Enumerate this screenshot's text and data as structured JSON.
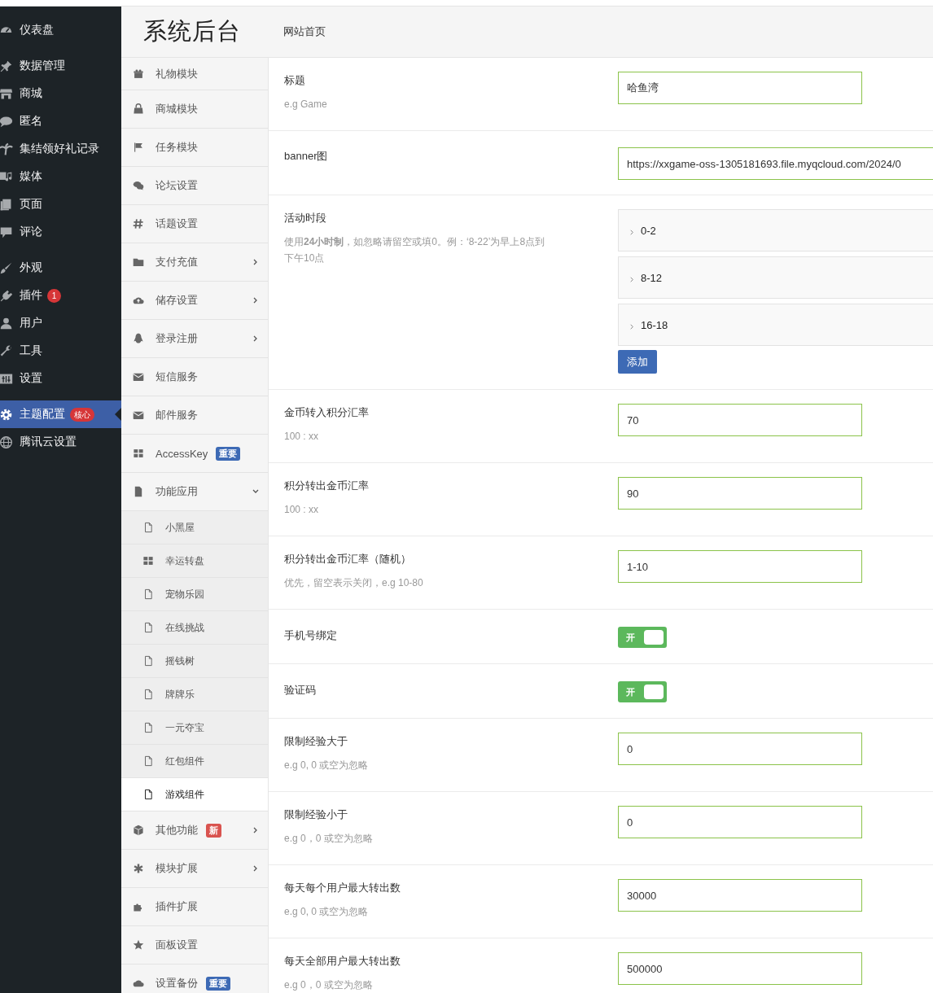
{
  "sidebar": {
    "items": [
      {
        "label": "仪表盘",
        "selected": false
      },
      {
        "label": "数据管理",
        "selected": false
      },
      {
        "label": "商城",
        "selected": false
      },
      {
        "label": "匿名",
        "selected": false
      },
      {
        "label": "集结领好礼记录",
        "selected": false
      },
      {
        "label": "媒体",
        "selected": false
      },
      {
        "label": "页面",
        "selected": false
      },
      {
        "label": "评论",
        "selected": false
      },
      {
        "label": "外观",
        "selected": false
      },
      {
        "label": "插件",
        "selected": false,
        "badge": "1"
      },
      {
        "label": "用户",
        "selected": false
      },
      {
        "label": "工具",
        "selected": false
      },
      {
        "label": "设置",
        "selected": false
      },
      {
        "label": "主题配置",
        "selected": true,
        "badge": "核心"
      },
      {
        "label": "腾讯云设置",
        "selected": false
      }
    ]
  },
  "header": {
    "title": "系统后台",
    "link": "网站首页"
  },
  "nav": {
    "items": [
      {
        "label": "礼物模块",
        "submenu": false
      },
      {
        "label": "商城模块",
        "submenu": false
      },
      {
        "label": "任务模块",
        "submenu": false
      },
      {
        "label": "论坛设置",
        "submenu": false
      },
      {
        "label": "话题设置",
        "submenu": false
      },
      {
        "label": "支付充值",
        "submenu": true,
        "expanded": false
      },
      {
        "label": "储存设置",
        "submenu": true,
        "expanded": false
      },
      {
        "label": "登录注册",
        "submenu": true,
        "expanded": false
      },
      {
        "label": "短信服务",
        "submenu": false
      },
      {
        "label": "邮件服务",
        "submenu": false
      },
      {
        "label": "AccessKey",
        "submenu": false,
        "badge": "重要",
        "color": "#3d6ab5"
      },
      {
        "label": "功能应用",
        "submenu": true,
        "expanded": true,
        "children": [
          {
            "label": "小黑屋",
            "selected": false
          },
          {
            "label": "幸运转盘",
            "selected": false
          },
          {
            "label": "宠物乐园",
            "selected": false
          },
          {
            "label": "在线挑战",
            "selected": false
          },
          {
            "label": "摇钱树",
            "selected": false
          },
          {
            "label": "牌牌乐",
            "selected": false
          },
          {
            "label": "一元夺宝",
            "selected": false
          },
          {
            "label": "红包组件",
            "selected": false
          },
          {
            "label": "游戏组件",
            "selected": true
          }
        ]
      },
      {
        "label": "其他功能",
        "submenu": true,
        "expanded": false,
        "badge": "新",
        "color": "#d9534f"
      },
      {
        "label": "模块扩展",
        "submenu": true,
        "expanded": false
      },
      {
        "label": "插件扩展",
        "submenu": false
      },
      {
        "label": "面板设置",
        "submenu": false
      },
      {
        "label": "设置备份",
        "submenu": false,
        "badge": "重要",
        "color": "#3d6ab5"
      }
    ]
  },
  "form": {
    "rows": [
      {
        "kind": "text",
        "label": "标题",
        "hint": "e.g Game",
        "value": "哈鱼湾"
      },
      {
        "kind": "wide",
        "label": "banner图",
        "value": "https://xxgame-oss-1305181693.file.myqcloud.com/2024/0"
      },
      {
        "kind": "slots",
        "label": "活动时段",
        "hint": "使用**24小时制**，如忽略请留空或填0。例：‘8-22’为早上8点到下午10点",
        "slots": [
          "0-2",
          "8-12",
          "16-18"
        ],
        "button": "添加"
      },
      {
        "kind": "text",
        "label": "金币转入积分汇率",
        "hint": "100 : xx",
        "value": "70"
      },
      {
        "kind": "text",
        "label": "积分转出金币汇率",
        "hint": "100 : xx",
        "value": "90"
      },
      {
        "kind": "text",
        "label": "积分转出金币汇率（随机）",
        "hint": "优先，留空表示关闭，e.g 10-80",
        "value": "1-10"
      },
      {
        "kind": "toggle",
        "label": "手机号绑定",
        "on": true,
        "toggle_label": "开"
      },
      {
        "kind": "toggle",
        "label": "验证码",
        "on": true,
        "toggle_label": "开"
      },
      {
        "kind": "text",
        "label": "限制经验大于",
        "hint": "e.g 0, 0 或空为忽略",
        "value": "0"
      },
      {
        "kind": "text",
        "label": "限制经验小于",
        "hint": "e.g 0，0 或空为忽略",
        "value": "0"
      },
      {
        "kind": "text",
        "label": "每天每个用户最大转出数",
        "hint": "e.g 0, 0 或空为忽略",
        "value": "30000"
      },
      {
        "kind": "text",
        "label": "每天全部用户最大转出数",
        "hint": "e.g 0，0 或空为忽略",
        "value": "500000"
      }
    ]
  }
}
